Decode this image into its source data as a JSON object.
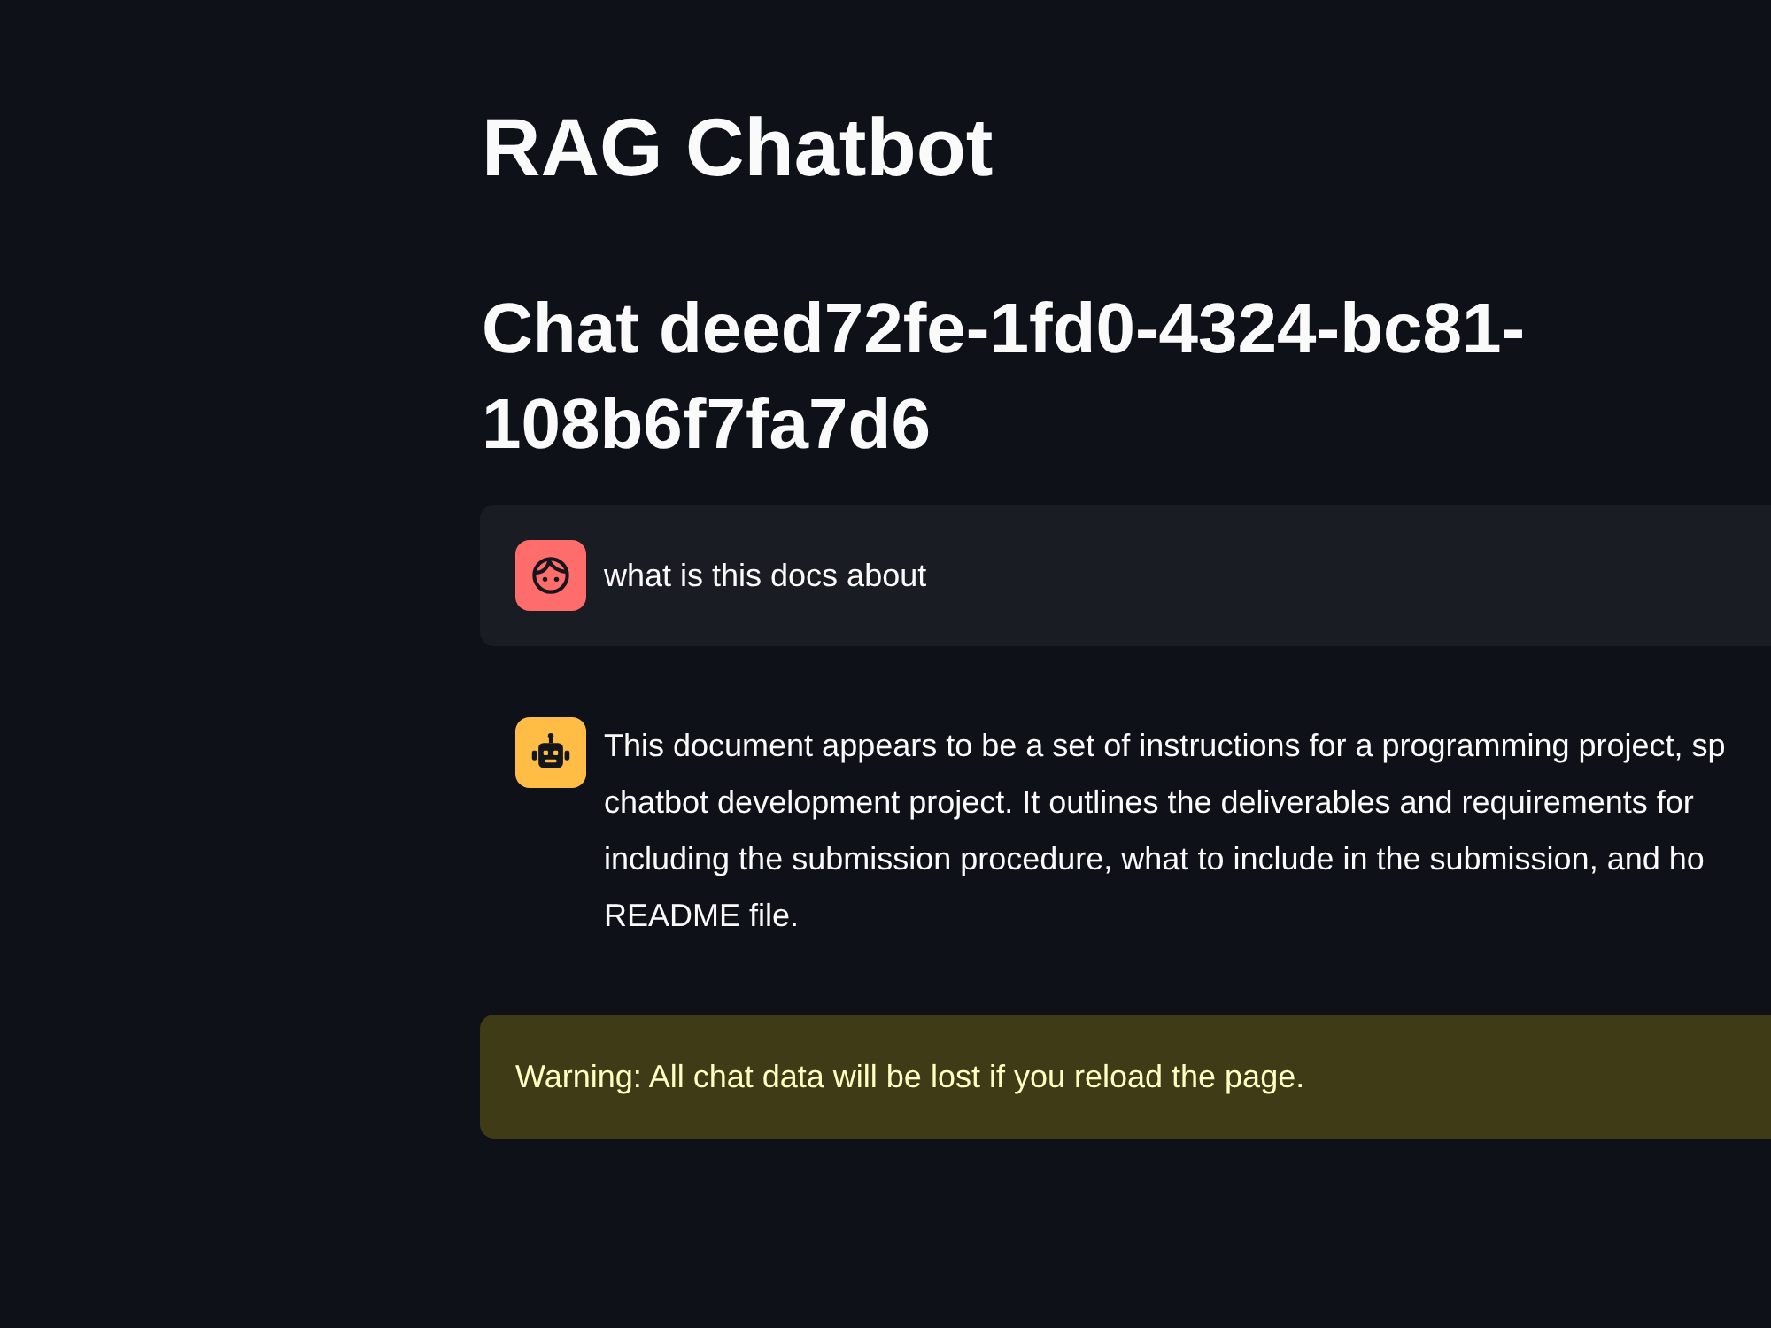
{
  "title": "RAG Chatbot",
  "chat_heading": "Chat deed72fe-1fd0-4324-bc81-108b6f7fa7d6",
  "messages": [
    {
      "kind": "user",
      "lines": [
        "what is this docs about"
      ]
    },
    {
      "kind": "assistant",
      "lines": [
        "This document appears to be a set of instructions for a programming project, sp",
        "chatbot development project. It outlines the deliverables and requirements for",
        "including the submission procedure, what to include in the submission, and ho",
        "README file."
      ]
    }
  ],
  "alert": {
    "kind": "warning",
    "text": "Warning: All chat data will be lost if you reload the page."
  }
}
